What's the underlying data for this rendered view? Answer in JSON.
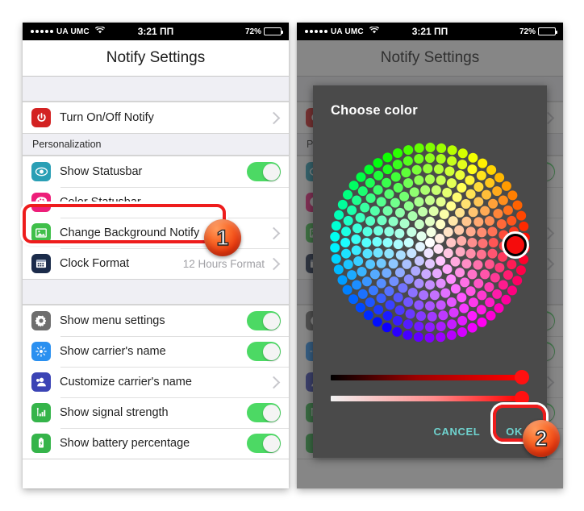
{
  "statusbar": {
    "carrier": "UA UMC",
    "signal_dots": 5,
    "wifi_icon": "wifi-icon",
    "time": "3:21 ПП",
    "battery_percent": "72%",
    "battery_level": 72
  },
  "navbar": {
    "title": "Notify Settings"
  },
  "left_panel": {
    "groups": [
      {
        "rows": [
          {
            "icon": "power-icon",
            "icon_color": "#d32222",
            "label": "Turn On/Off Notify",
            "accessory": "chevron"
          }
        ]
      },
      {
        "header": "Personalization",
        "rows": [
          {
            "icon": "eye-icon",
            "icon_color": "#2a9fb5",
            "label": "Show Statusbar",
            "accessory": "toggle",
            "toggle_on": true
          },
          {
            "icon": "palette-icon",
            "icon_color": "#ed1e79",
            "label": "Color Statusbar",
            "accessory": "none"
          },
          {
            "icon": "image-icon",
            "icon_color": "#3fbf4a",
            "label": "Change Background Notify",
            "accessory": "chevron"
          },
          {
            "icon": "calendar-icon",
            "icon_color": "#1b2b4a",
            "label": "Clock Format",
            "value": "12 Hours Format",
            "accessory": "chevron"
          }
        ]
      },
      {
        "rows": [
          {
            "icon": "gear-icon",
            "icon_color": "#6e6e6e",
            "label": "Show menu settings",
            "accessory": "toggle",
            "toggle_on": true
          },
          {
            "icon": "brightness-icon",
            "icon_color": "#2a90f0",
            "label": "Show carrier's name",
            "accessory": "toggle",
            "toggle_on": true
          },
          {
            "icon": "person-icon",
            "icon_color": "#3b44b5",
            "label": "Customize carrier's name",
            "accessory": "chevron"
          },
          {
            "icon": "signal-bars-icon",
            "icon_color": "#35b44a",
            "label": "Show signal strength",
            "accessory": "toggle",
            "toggle_on": true
          },
          {
            "icon": "battery-icon",
            "icon_color": "#35b44a",
            "label": "Show battery percentage",
            "accessory": "toggle",
            "toggle_on": true
          }
        ]
      }
    ]
  },
  "dialog": {
    "title": "Choose color",
    "cancel_label": "CANCEL",
    "ok_label": "OK",
    "selected_color": "#f50c0c",
    "value_slider_percent": 100,
    "saturation_slider_percent": 100,
    "accent_color": "#6fd3cf"
  },
  "annotations": {
    "badge_one": "1",
    "badge_two": "2",
    "highlight_color": "#ee1c1c"
  }
}
